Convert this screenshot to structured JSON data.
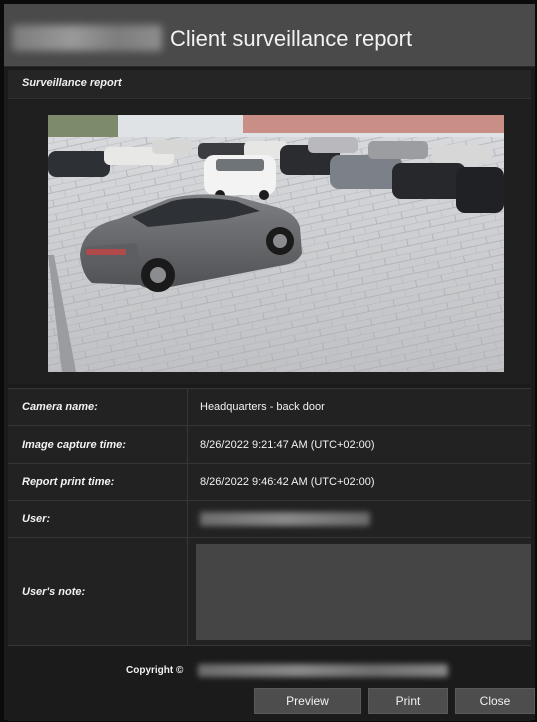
{
  "header": {
    "title": "Client surveillance report"
  },
  "section": {
    "title": "Surveillance report"
  },
  "snapshot": {
    "description_icon": "camera-snapshot-image"
  },
  "details": {
    "camera_name_label": "Camera name:",
    "camera_name_value": "Headquarters - back door",
    "capture_time_label": "Image capture time:",
    "capture_time_value": "8/26/2022 9:21:47 AM (UTC+02:00)",
    "print_time_label": "Report print time:",
    "print_time_value": "8/26/2022 9:46:42 AM (UTC+02:00)",
    "user_label": "User:",
    "user_value": "",
    "note_label": "User's note:",
    "note_value": ""
  },
  "footer": {
    "copyright_label": "Copyright ©",
    "preview_label": "Preview",
    "print_label": "Print",
    "close_label": "Close"
  }
}
